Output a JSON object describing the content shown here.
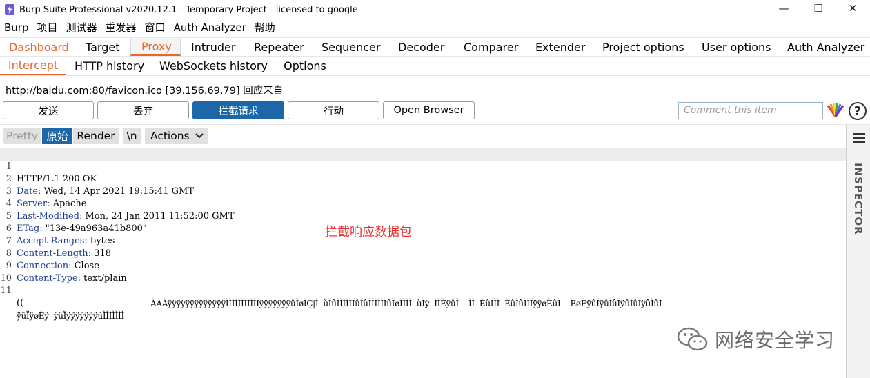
{
  "window": {
    "title": "Burp Suite Professional v2020.12.1 - Temporary Project - licensed to google",
    "minimize": "—",
    "maximize": "☐",
    "close": "✕"
  },
  "menu": [
    "Burp",
    "项目",
    "测试器",
    "重发器",
    "窗口",
    "Auth Analyzer",
    "帮助"
  ],
  "main_tabs": [
    "Dashboard",
    "Target",
    "Proxy",
    "Intruder",
    "Repeater",
    "Sequencer",
    "Decoder",
    "Comparer",
    "Extender",
    "Project options",
    "User options",
    "Auth Analyzer"
  ],
  "sub_tabs": [
    "Intercept",
    "HTTP history",
    "WebSockets history",
    "Options"
  ],
  "request_info": "http://baidu.com:80/favicon.ico  [39.156.69.79] 回应来自",
  "buttons": {
    "forward": "发送",
    "drop": "丢弃",
    "intercept": "拦截请求",
    "action": "行动",
    "open_browser": "Open Browser"
  },
  "comment_placeholder": "Comment this item",
  "help": "?",
  "editor_toolbar": {
    "pretty": "Pretty",
    "raw": "原始",
    "render": "Render",
    "newline": "\\n",
    "actions": "Actions"
  },
  "response_lines": [
    {
      "n": "1",
      "key": "",
      "value": "HTTP/1.1 200 OK"
    },
    {
      "n": "2",
      "key": "Date:",
      "value": " Wed, 14 Apr 2021 19:15:41 GMT"
    },
    {
      "n": "3",
      "key": "Server:",
      "value": " Apache"
    },
    {
      "n": "4",
      "key": "Last-Modified:",
      "value": " Mon, 24 Jan 2011 11:52:00 GMT"
    },
    {
      "n": "5",
      "key": "ETag:",
      "value": " \"13e-49a963a41b800\""
    },
    {
      "n": "6",
      "key": "Accept-Ranges:",
      "value": " bytes"
    },
    {
      "n": "7",
      "key": "Content-Length:",
      "value": " 318"
    },
    {
      "n": "8",
      "key": "Connection:",
      "value": " Close"
    },
    {
      "n": "9",
      "key": "Content-Type:",
      "value": " text/plain"
    },
    {
      "n": "10",
      "key": "",
      "value": ""
    },
    {
      "n": "11",
      "key": "",
      "value": "(("
    }
  ],
  "body_line_2": "ÀÀÀÿÿÿÿÿÿÿÿÿÿÿÿÿÌÌÌÌÌÌÌÌÌÌÏÿÿÿÿÿÿÿûÏøÌÇ|Ì  ùÏûÌÌÌÌÌÏûÏûÌÌÌÌÌÏûÏøÌÌÌÌ  ùÏÿ  ÌÌÈÿûÏ    ÌÌ  ÈûÏÌÌ  ÈûÌûÏÌÏÿÿøÈûÏ    ÈøÈÿûÏÿûÌûÏÿûÌûÏÿûÌûÌ",
  "body_line_3": "ÿûÏÿøÈÿ  ÿûÏÿÿÿÿÿÿÿûÌÌÌÌÌÌÌ",
  "annotation": "拦截响应数据包",
  "watermark": "网络安全学习",
  "inspector_label": "INSPECTOR",
  "colors": {
    "accent": "#e9652a",
    "primary_button": "#1b67a8",
    "header_key": "#1c3d8f",
    "annotation": "#e8342f"
  }
}
